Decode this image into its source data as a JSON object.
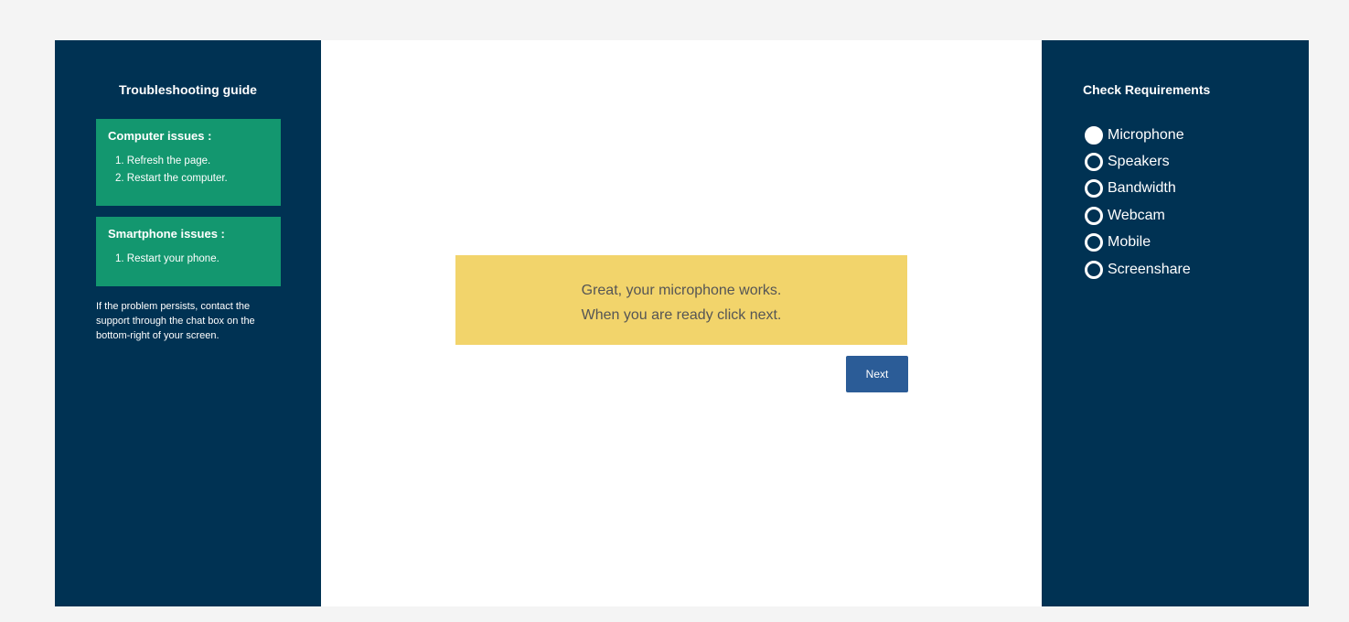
{
  "troubleshooting": {
    "title": "Troubleshooting guide",
    "computer": {
      "title": "Computer issues :",
      "steps": [
        "1. Refresh the page.",
        "2. Restart the computer."
      ]
    },
    "smartphone": {
      "title": "Smartphone issues :",
      "steps": [
        "1. Restart your phone."
      ]
    },
    "help_text": "If the problem persists, contact the support through the chat box on the bottom-right of your screen."
  },
  "message": {
    "line1": "Great, your microphone works.",
    "line2": "When you are ready click next."
  },
  "next_button": {
    "label": "Next"
  },
  "requirements": {
    "title": "Check Requirements",
    "items": [
      {
        "label": "Microphone",
        "checked": true
      },
      {
        "label": "Speakers",
        "checked": false
      },
      {
        "label": "Bandwidth",
        "checked": false
      },
      {
        "label": "Webcam",
        "checked": false
      },
      {
        "label": "Mobile",
        "checked": false
      },
      {
        "label": "Screenshare",
        "checked": false
      }
    ]
  },
  "colors": {
    "panel": "#003253",
    "issue_box": "#13976f",
    "message_box": "#f2d46b",
    "button": "#2b5c97"
  }
}
